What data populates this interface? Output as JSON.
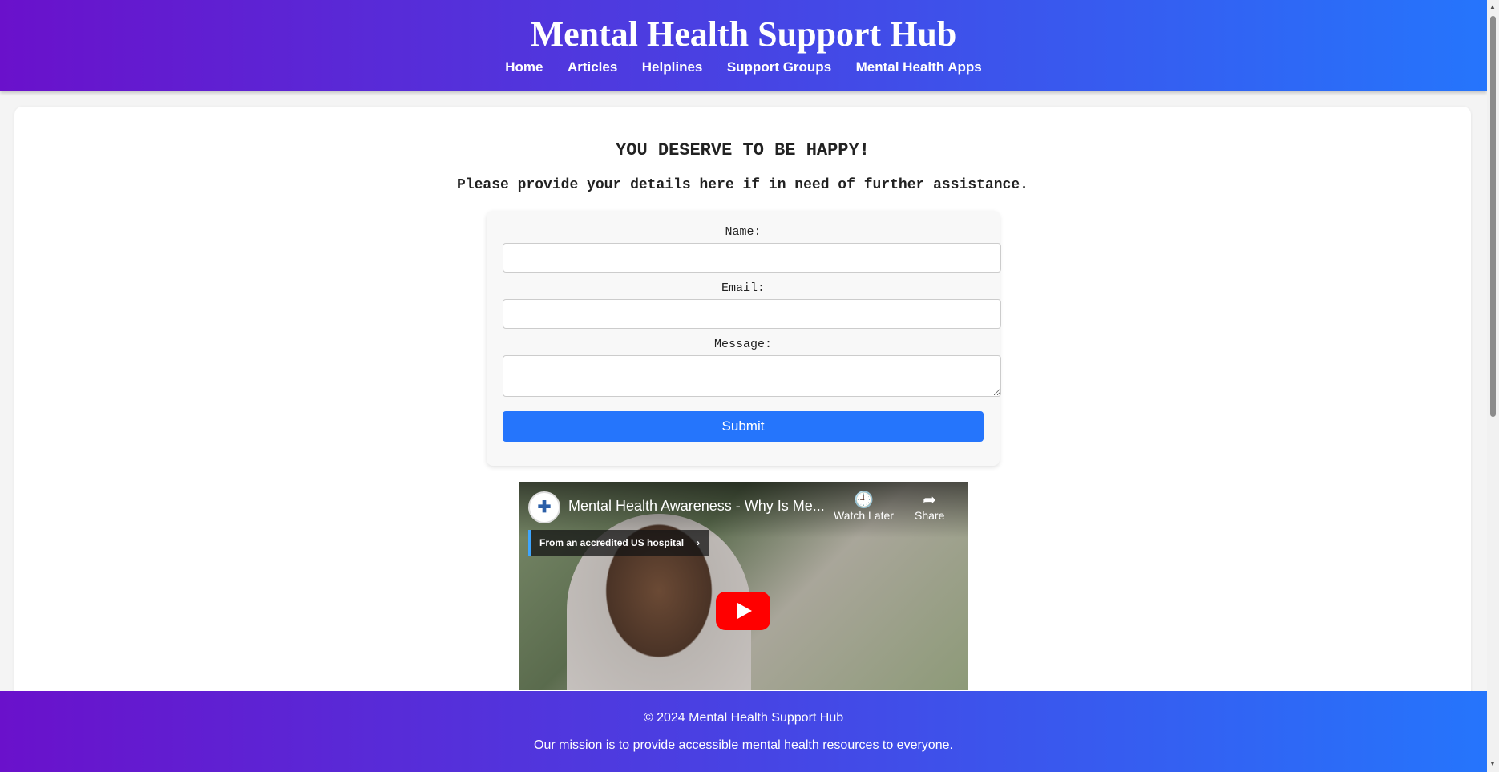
{
  "header": {
    "title": "Mental Health Support Hub",
    "nav": [
      "Home",
      "Articles",
      "Helplines",
      "Support Groups",
      "Mental Health Apps"
    ]
  },
  "main": {
    "headline": "YOU DESERVE TO BE HAPPY!",
    "subline": "Please provide your details here if in need of further assistance."
  },
  "form": {
    "name_label": "Name:",
    "name_value": "",
    "email_label": "Email:",
    "email_value": "",
    "message_label": "Message:",
    "message_value": "",
    "submit_label": "Submit"
  },
  "video": {
    "title": "Mental Health Awareness - Why Is Me...",
    "watch_later": "Watch Later",
    "share": "Share",
    "chip": "From an accredited US hospital"
  },
  "footer": {
    "copyright": "© 2024 Mental Health Support Hub",
    "mission": "Our mission is to provide accessible mental health resources to everyone."
  }
}
